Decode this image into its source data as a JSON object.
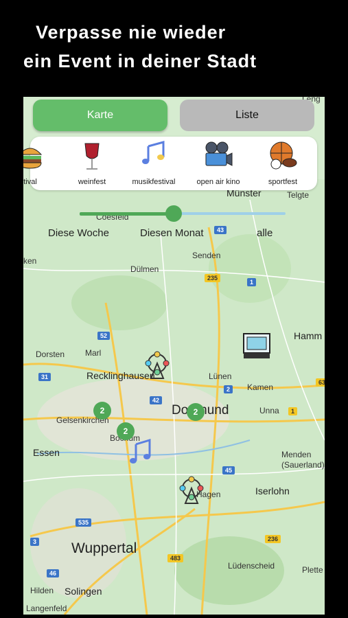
{
  "headline": {
    "line1": "Verpasse nie wieder",
    "line2": "ein Event in deiner Stadt"
  },
  "tabs": {
    "map": "Karte",
    "list": "Liste"
  },
  "categories": [
    {
      "label": "tival",
      "icon": "burger-icon"
    },
    {
      "label": "weinfest",
      "icon": "wine-glass-icon"
    },
    {
      "label": "musikfestival",
      "icon": "music-notes-icon"
    },
    {
      "label": "open air kino",
      "icon": "film-camera-icon"
    },
    {
      "label": "sportfest",
      "icon": "sports-balls-icon"
    }
  ],
  "time_filter": {
    "week": "Diese Woche",
    "month": "Diesen Monat",
    "all": "alle"
  },
  "map": {
    "places": {
      "leng": "Leng",
      "muenster": "Münster",
      "telgte": "Telgte",
      "coesfeld": "Coesfeld",
      "ken": "ken",
      "senden": "Senden",
      "duelmen": "Dülmen",
      "hamm": "Hamm",
      "dorsten": "Dorsten",
      "marl": "Marl",
      "recklinghausen": "Recklinghausen",
      "luenen": "Lünen",
      "kamen": "Kamen",
      "gelsenkirchen": "Gelsenkirchen",
      "dortmund": "Dortmund",
      "unna": "Unna",
      "bochum": "Bochum",
      "essen": "Essen",
      "menden": "Menden (Sauerland)",
      "hagen": "Hagen",
      "iserlohn": "Iserlohn",
      "wuppertal": "Wuppertal",
      "luedenscheid": "Lüdenscheid",
      "plette": "Plette",
      "hilden": "Hilden",
      "solingen": "Solingen",
      "langenfeld": "Langenfeld"
    },
    "roads": [
      "43",
      "235",
      "1",
      "52",
      "31",
      "42",
      "2",
      "1",
      "45",
      "535",
      "3",
      "236",
      "483",
      "46",
      "63"
    ],
    "clusters": [
      "2",
      "2",
      "2"
    ]
  },
  "colors": {
    "accent": "#64bd6a",
    "tab_inactive": "#b9b9b9",
    "map_bg": "#cfe8c8"
  }
}
